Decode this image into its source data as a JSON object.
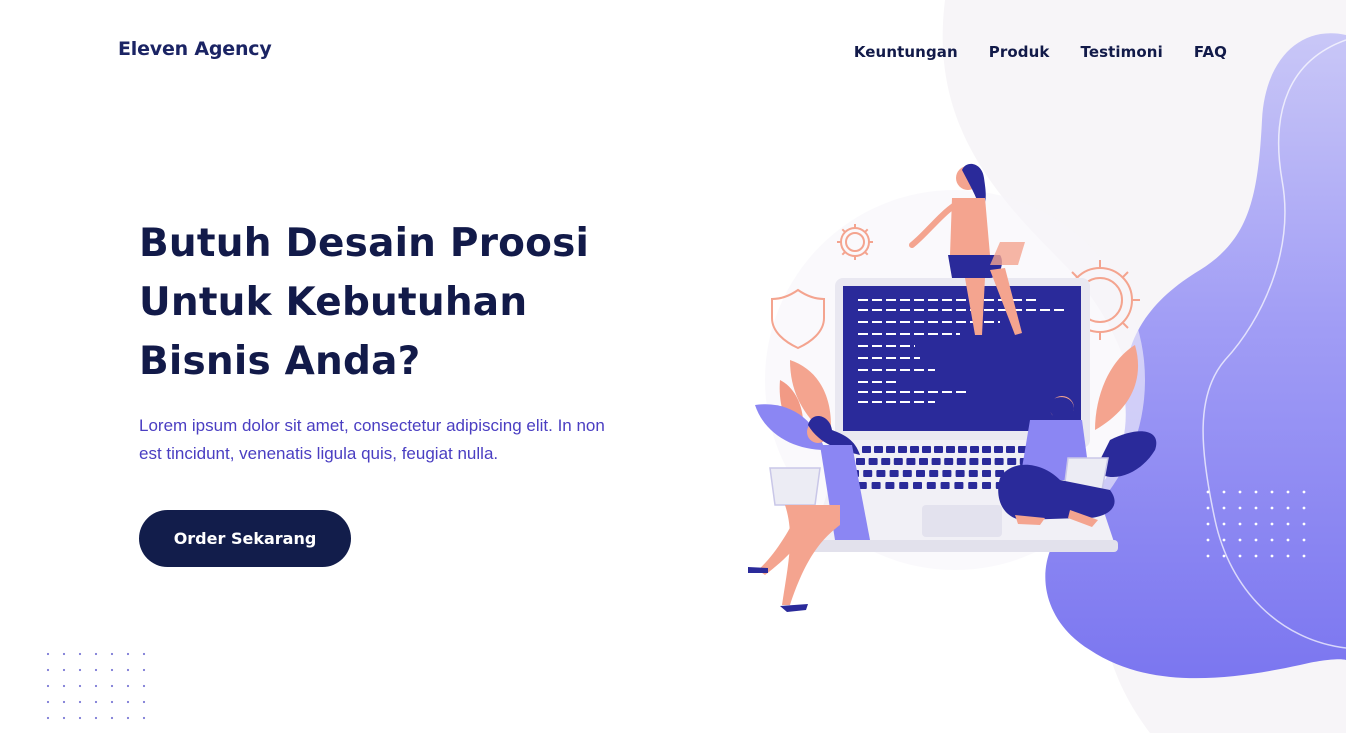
{
  "header": {
    "logo": "Eleven Agency",
    "nav": [
      {
        "label": "Keuntungan"
      },
      {
        "label": "Produk"
      },
      {
        "label": "Testimoni"
      },
      {
        "label": "FAQ"
      }
    ]
  },
  "hero": {
    "title_lines": [
      "Butuh Desain Proosi",
      "Untuk Kebutuhan",
      "Bisnis Anda?"
    ],
    "description": "Lorem ipsum dolor sit amet, consectetur adipiscing elit. In non est tincidunt, venenatis ligula quis, feugiat nulla.",
    "cta_label": "Order Sekarang"
  },
  "colors": {
    "navy": "#121a49",
    "accent": "#4a3ec2",
    "blob_purple": "#8b86f3",
    "salmon": "#f4a48f",
    "laptop_screen": "#2a2a9a"
  },
  "icons": [
    "gear-icon",
    "shield-icon",
    "dot-grid"
  ]
}
